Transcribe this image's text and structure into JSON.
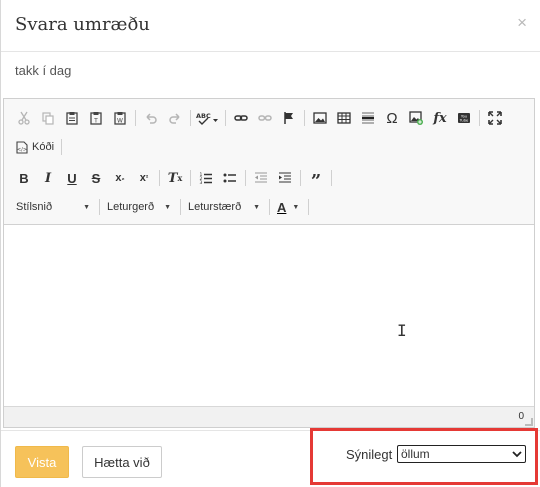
{
  "dialog": {
    "title": "Svara umræðu",
    "close_glyph": "×"
  },
  "subject": {
    "value": "takk í dag"
  },
  "toolbar": {
    "row1": [
      {
        "name": "cut-icon",
        "glyph": "✂",
        "enabled": false
      },
      {
        "name": "copy-icon",
        "glyph": "⎘",
        "enabled": false
      },
      {
        "name": "paste-icon",
        "glyph": "📋",
        "enabled": true
      },
      {
        "name": "paste-text-icon",
        "glyph": "📋",
        "enabled": true
      },
      {
        "name": "paste-word-icon",
        "glyph": "📋",
        "enabled": true
      },
      {
        "name": "undo-icon",
        "glyph": "↶",
        "enabled": false
      },
      {
        "name": "redo-icon",
        "glyph": "↷",
        "enabled": false
      },
      {
        "name": "spellcheck-icon",
        "glyph": "ABC",
        "enabled": true
      },
      {
        "name": "link-icon",
        "glyph": "🔗",
        "enabled": true
      },
      {
        "name": "unlink-icon",
        "glyph": "⛓",
        "enabled": false
      },
      {
        "name": "anchor-flag-icon",
        "glyph": "⚑",
        "enabled": true
      },
      {
        "name": "image-icon",
        "glyph": "▣",
        "enabled": true
      },
      {
        "name": "table-icon",
        "glyph": "▦",
        "enabled": true
      },
      {
        "name": "horizontal-line-icon",
        "glyph": "≡",
        "enabled": true
      },
      {
        "name": "special-char-icon",
        "glyph": "Ω",
        "enabled": true
      },
      {
        "name": "insert-image-plus-icon",
        "glyph": "▣",
        "enabled": true
      },
      {
        "name": "formula-icon",
        "glyph": "fx",
        "enabled": true
      },
      {
        "name": "youtube-icon",
        "glyph": "▶",
        "enabled": true
      },
      {
        "name": "maximize-icon",
        "glyph": "⤢",
        "enabled": true
      }
    ],
    "source_label": "Kóði",
    "row3": [
      {
        "name": "bold-icon",
        "glyph": "B"
      },
      {
        "name": "italic-icon",
        "glyph": "I"
      },
      {
        "name": "underline-icon",
        "glyph": "U"
      },
      {
        "name": "strikethrough-icon",
        "glyph": "S"
      },
      {
        "name": "subscript-icon",
        "glyph": "x₂"
      },
      {
        "name": "superscript-icon",
        "glyph": "x²"
      },
      {
        "name": "remove-format-icon",
        "glyph": "Tx"
      },
      {
        "name": "numbered-list-icon",
        "glyph": "1≡"
      },
      {
        "name": "bulleted-list-icon",
        "glyph": "•≡"
      },
      {
        "name": "outdent-icon",
        "glyph": "⇤"
      },
      {
        "name": "indent-icon",
        "glyph": "⇥"
      },
      {
        "name": "blockquote-icon",
        "glyph": "❞"
      }
    ],
    "styles_label": "Stílsnið",
    "font_label": "Leturgerð",
    "size_label": "Leturstærð",
    "text_color_label": "A"
  },
  "editor": {
    "content": "",
    "word_count": "0"
  },
  "footer": {
    "save_label": "Vista",
    "cancel_label": "Hætta við",
    "visibility_label": "Sýnilegt",
    "visibility_value": "öllum"
  },
  "colors": {
    "save_button": "#f6c25a",
    "highlight_border": "#e53935"
  }
}
